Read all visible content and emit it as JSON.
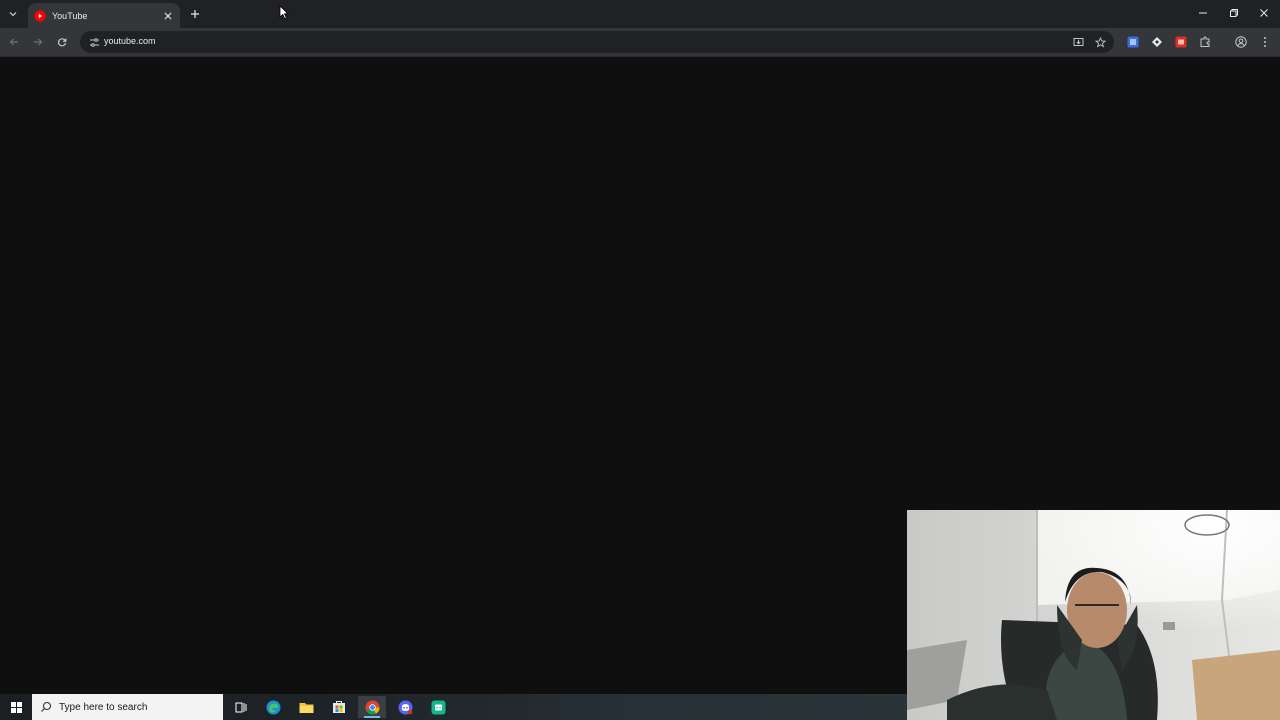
{
  "browser": {
    "tab": {
      "title": "YouTube",
      "favicon": "youtube-icon"
    },
    "address": {
      "url": "youtube.com"
    },
    "icons": [
      "tab-search-icon",
      "close-icon",
      "new-tab-icon",
      "minimize-icon",
      "restore-icon",
      "window-close-icon",
      "back-icon",
      "forward-icon",
      "reload-icon",
      "site-info-icon",
      "install-app-icon",
      "bookmark-star-icon",
      "translate-extension-icon",
      "diamond-extension-icon",
      "red-extension-icon",
      "extensions-puzzle-icon",
      "profile-icon",
      "menu-kebab-icon"
    ]
  },
  "taskbar": {
    "search_placeholder": "Type here to search",
    "apps": [
      "task-view-icon",
      "edge-icon",
      "file-explorer-icon",
      "store-icon",
      "chrome-icon",
      "discord-icon",
      "app-icon"
    ],
    "active_app": "chrome-icon"
  },
  "colors": {
    "page_bg": "#0f0f0f",
    "tabstrip_bg": "#202124",
    "toolbar_bg": "#35363a",
    "youtube_red": "#ff0000",
    "taskbar_search_bg": "#f3f3f3"
  }
}
